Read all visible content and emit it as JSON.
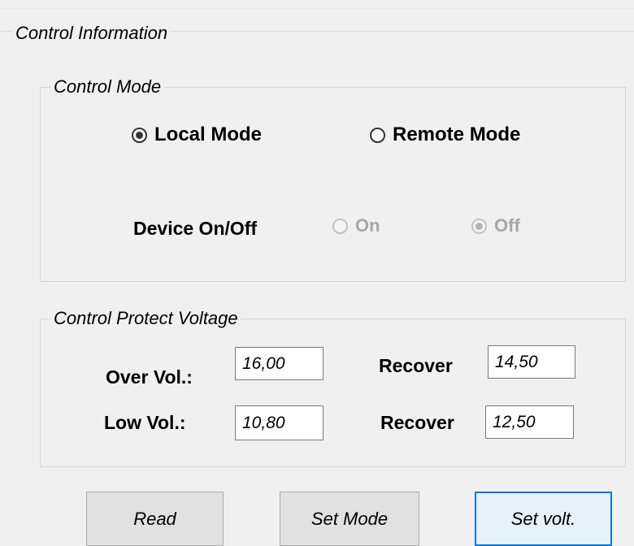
{
  "control_info": {
    "legend": "Control Information",
    "control_mode": {
      "legend": "Control Mode",
      "local_mode": {
        "label": "Local Mode",
        "checked": true
      },
      "remote_mode": {
        "label": "Remote Mode",
        "checked": false
      },
      "device_label": "Device On/Off",
      "device_on": {
        "label": "On",
        "checked": false,
        "enabled": false
      },
      "device_off": {
        "label": "Off",
        "checked": true,
        "enabled": false
      }
    },
    "protect_voltage": {
      "legend": "Control Protect Voltage",
      "over_label": "Over Vol.:",
      "over_value": "16,00",
      "over_recover_label": "Recover",
      "over_recover_value": "14,50",
      "low_label": "Low Vol.:",
      "low_value": "10,80",
      "low_recover_label": "Recover",
      "low_recover_value": "12,50"
    }
  },
  "buttons": {
    "read": "Read",
    "set_mode": "Set Mode",
    "set_volt": "Set volt."
  }
}
